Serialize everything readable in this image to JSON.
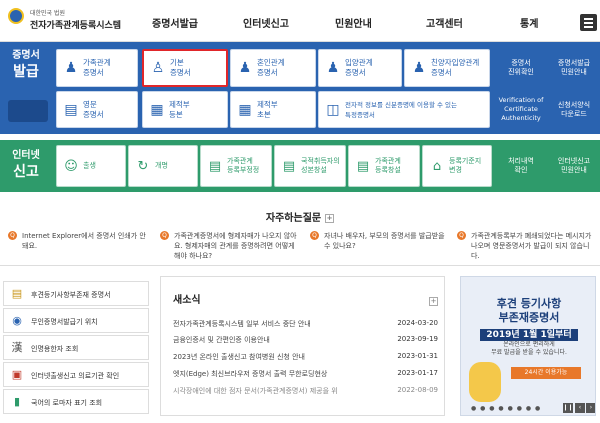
{
  "header": {
    "gov_label": "대한민국 법원",
    "site_title": "전자가족관계등록시스템",
    "nav": [
      "증명서발급",
      "인터넷신고",
      "민원안내",
      "고객센터",
      "통계"
    ]
  },
  "cert": {
    "title_small": "증명서",
    "title_big": "발급",
    "row1": [
      {
        "label": "가족관계\n증명서",
        "icon": "family-icon"
      },
      {
        "label": "기본\n증명서",
        "icon": "person-icon",
        "selected": true
      },
      {
        "label": "혼인관계\n증명서",
        "icon": "couple-icon"
      },
      {
        "label": "입양관계\n증명서",
        "icon": "adoption-icon"
      },
      {
        "label": "친양자입양관계\n증명서",
        "icon": "adoption-full-icon"
      }
    ],
    "row2": [
      {
        "label": "영문\n증명서",
        "icon": "english-doc-icon"
      },
      {
        "label": "제적부\n등본",
        "icon": "register-icon"
      },
      {
        "label": "제적부\n초본",
        "icon": "register-excerpt-icon"
      },
      {
        "label": "전자적 정보를 신분증명에 이용할 수 있는\n특정증명서",
        "icon": "id-card-icon"
      }
    ],
    "right": [
      {
        "label": "증명서\n진위확인"
      },
      {
        "label": "증명서발급\n민원안내"
      },
      {
        "label": "Verification of\nCertificate\nAuthenticity"
      },
      {
        "label": "신청서양식\n다운로드"
      }
    ]
  },
  "report": {
    "title_small": "인터넷",
    "title_big": "신고",
    "items": [
      {
        "label": "출생",
        "icon": "baby-icon"
      },
      {
        "label": "개명",
        "icon": "rename-icon"
      },
      {
        "label": "가족관계\n등록부정정",
        "icon": "correction-icon"
      },
      {
        "label": "국적취득자의\n성본창설",
        "icon": "nationality-icon"
      },
      {
        "label": "가족관계\n등록창설",
        "icon": "creation-icon"
      },
      {
        "label": "등록기준지\n변경",
        "icon": "home-icon"
      }
    ],
    "right": [
      {
        "label": "처리내역\n확인"
      },
      {
        "label": "인터넷신고\n민원안내"
      }
    ]
  },
  "faq": {
    "title": "자주하는질문",
    "items": [
      "Internet Explorer에서 증명서 인쇄가 안돼요.",
      "가족관계증명서에 형제자매가 나오지 않아요. 형제자매의 관계를 증명하려면 어떻게 해야 하나요?",
      "자녀나 배우자, 부모의 증명서를 발급받을 수 있나요?",
      "가족관계등록부가 폐쇄되었다는 메시지가 나오며 영문증명서가 발급이 되지 않습니다."
    ]
  },
  "links": [
    {
      "label": "후견등기사항부존재 증명서",
      "icon": "doc-icon"
    },
    {
      "label": "무인증명서발급기 위치",
      "icon": "location-icon"
    },
    {
      "label": "인명용한자 조회",
      "icon": "hanja-icon"
    },
    {
      "label": "인터넷출생신고 의료기관 확인",
      "icon": "hospital-icon"
    },
    {
      "label": "국어의 로마자 표기 조회",
      "icon": "book-icon"
    }
  ],
  "news": {
    "title": "새소식",
    "items": [
      {
        "text": "전자가족관계등록시스템 일부 서비스 중단 안내",
        "date": "2024-03-20"
      },
      {
        "text": "금융인증서 및 간편인증 이용안내",
        "date": "2023-09-19"
      },
      {
        "text": "2023년 온라인 출생신고 참여병원 신청 안내",
        "date": "2023-01-31"
      },
      {
        "text": "엣지(Edge) 최신브라우저 증명서 출력 무한로딩현상",
        "date": "2023-01-17"
      },
      {
        "text": "시각장애인에 대한 점자 문서(가족관계증명서) 제공을 위",
        "date": "2022-08-09"
      }
    ]
  },
  "banner": {
    "line1": "후견 등기사항",
    "line2": "부존재증명서",
    "line3": "2019년 1월 1일부터",
    "line4": "온라인으로 편리하게\n무료 발급을 받을 수 있습니다.",
    "button": "24시간 이용가능"
  }
}
